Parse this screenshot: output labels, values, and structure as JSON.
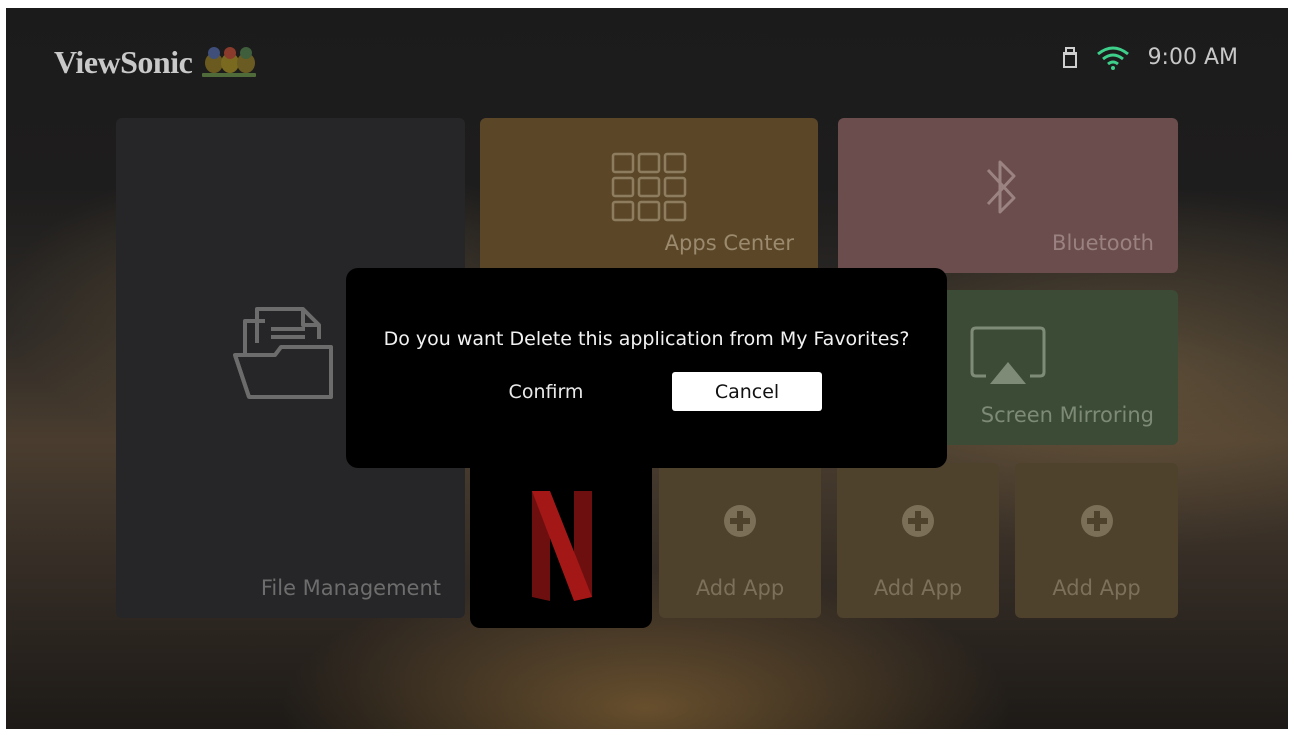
{
  "header": {
    "brand": "ViewSonic",
    "clock": "9:00 AM",
    "icons": [
      "usb-icon",
      "wifi-icon"
    ]
  },
  "tiles": {
    "file_management": "File Management",
    "apps_center": "Apps Center",
    "bluetooth": "Bluetooth",
    "screen_mirroring": "Screen Mirroring",
    "netflix_icon": "netflix-logo-icon",
    "add_app": [
      "Add App",
      "Add App",
      "Add App"
    ]
  },
  "dialog": {
    "message": "Do you want Delete this application from My Favorites?",
    "confirm_label": "Confirm",
    "cancel_label": "Cancel"
  },
  "colors": {
    "apps_center": "#5b4628",
    "bluetooth": "#6a4d4c",
    "screen_mirroring": "#3c4b35",
    "add_app": "#4e422d",
    "netflix_red": "#8a1414"
  }
}
